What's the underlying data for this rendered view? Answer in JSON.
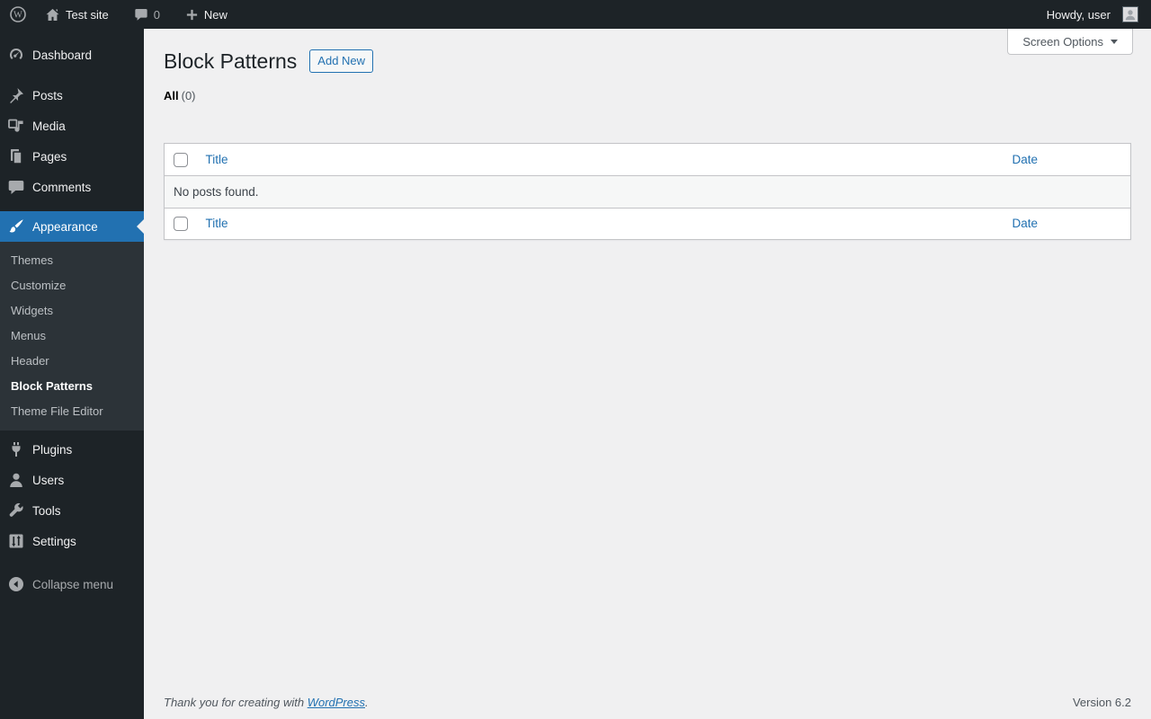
{
  "admin_bar": {
    "site_name": "Test site",
    "comments_count": "0",
    "new_label": "New",
    "howdy_label": "Howdy, user"
  },
  "icons": {
    "wp_logo_letter": "W"
  },
  "sidebar": {
    "items": [
      {
        "label": "Dashboard"
      },
      {
        "label": "Posts"
      },
      {
        "label": "Media"
      },
      {
        "label": "Pages"
      },
      {
        "label": "Comments"
      },
      {
        "label": "Appearance"
      },
      {
        "label": "Plugins"
      },
      {
        "label": "Users"
      },
      {
        "label": "Tools"
      },
      {
        "label": "Settings"
      }
    ],
    "appearance_submenu": [
      {
        "label": "Themes"
      },
      {
        "label": "Customize"
      },
      {
        "label": "Widgets"
      },
      {
        "label": "Menus"
      },
      {
        "label": "Header"
      },
      {
        "label": "Block Patterns"
      },
      {
        "label": "Theme File Editor"
      }
    ],
    "collapse_label": "Collapse menu"
  },
  "page": {
    "title": "Block Patterns",
    "add_new_label": "Add New",
    "screen_options_label": "Screen Options",
    "views": {
      "all_label": "All",
      "all_count": "(0)"
    }
  },
  "table": {
    "columns": {
      "title": "Title",
      "date": "Date"
    },
    "empty_message": "No posts found."
  },
  "footer": {
    "thanks_text": "Thank you for creating with ",
    "wordpress_link": "WordPress",
    "period": ".",
    "version": "Version 6.2"
  },
  "colors": {
    "accent_blue": "#2271b1",
    "admin_bar_bg": "#1d2327",
    "submenu_bg": "#2c3338",
    "content_bg": "#f0f0f1",
    "table_border": "#c3c4c7"
  }
}
